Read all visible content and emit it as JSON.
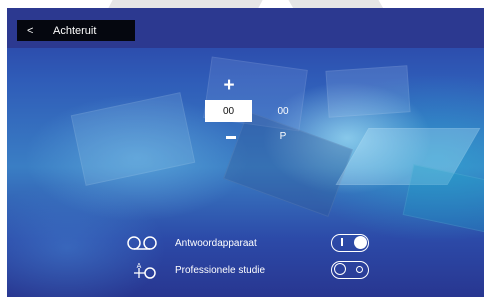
{
  "header": {
    "back_arrow": "<",
    "back_label": "Achteruit"
  },
  "time": {
    "increment_symbol": "+",
    "hour": "00",
    "minutes": "00",
    "period": "P"
  },
  "options": [
    {
      "icon": "voicemail-icon",
      "label": "Antwoordapparaat",
      "toggle_on": true
    },
    {
      "icon": "professional-studio-icon",
      "label": "Professionele studie",
      "toggle_on": false
    }
  ],
  "colors": {
    "topbar": "#2c3990",
    "back_button": "#05070f",
    "text": "#ffffff"
  }
}
